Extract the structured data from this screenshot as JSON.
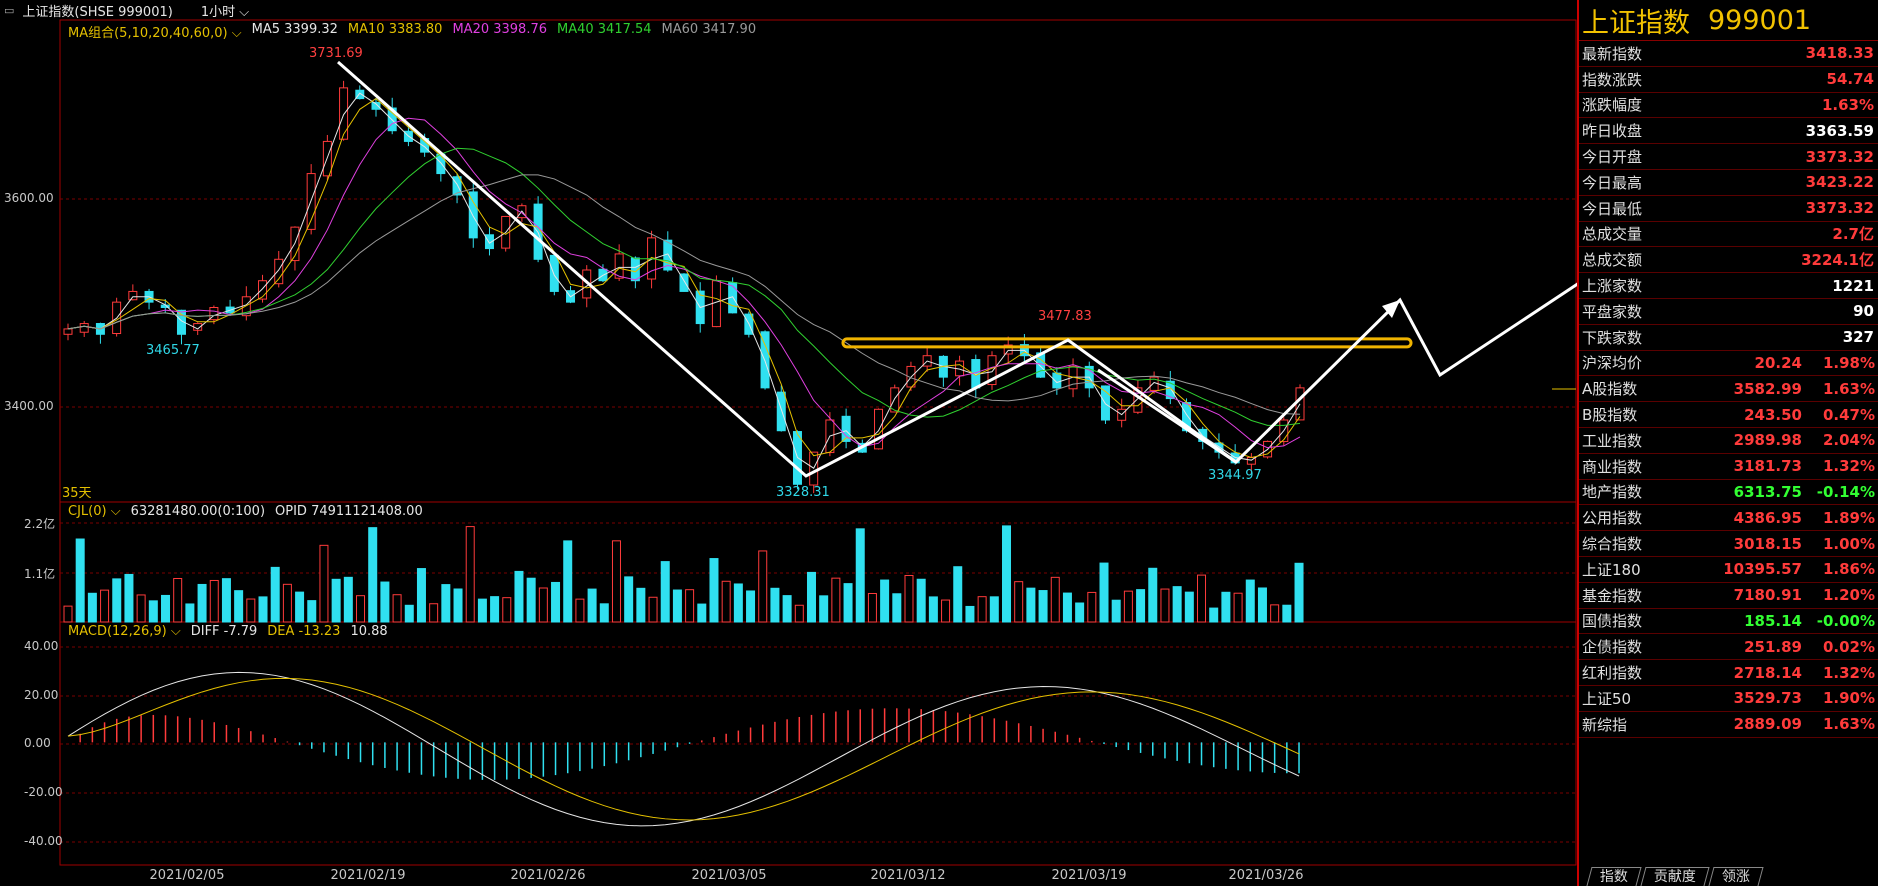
{
  "window": {
    "title": "上证指数(SHSE 999001)",
    "timeframe": "1小时"
  },
  "legends": {
    "ma": [
      {
        "text": "MA组合(5,10,20,40,60,0)",
        "color": "#e4c000"
      },
      {
        "text": "MA5 3399.32",
        "color": "#e6e6e6"
      },
      {
        "text": "MA10 3383.80",
        "color": "#e4c000"
      },
      {
        "text": "MA20 3398.76",
        "color": "#e040e0"
      },
      {
        "text": "MA40 3417.54",
        "color": "#30d030"
      },
      {
        "text": "MA60 3417.90",
        "color": "#9a9a9a"
      }
    ],
    "vol": [
      {
        "text": "CJL(0)",
        "color": "#e4c000"
      },
      {
        "text": "63281480.00(0:100)",
        "color": "#e6e6e6"
      },
      {
        "text": "OPID 74911121408.00",
        "color": "#e6e6e6"
      }
    ],
    "macd": [
      {
        "text": "MACD(12,26,9)",
        "color": "#e4c000"
      },
      {
        "text": "DIFF -7.79",
        "color": "#e6e6e6"
      },
      {
        "text": "DEA -13.23",
        "color": "#e4c000"
      },
      {
        "text": "10.88",
        "color": "#e6e6e6"
      }
    ]
  },
  "price_axis": [
    "3600.00",
    "3400.00"
  ],
  "vol_axis": [
    "2.2亿",
    "1.1亿"
  ],
  "macd_axis": [
    "40.00",
    "20.00",
    "0.00",
    "-20.00",
    "-40.00"
  ],
  "dates": [
    "2021/02/05",
    "2021/02/19",
    "2021/02/26",
    "2021/03/05",
    "2021/03/12",
    "2021/03/19",
    "2021/03/26"
  ],
  "days_label": "35天",
  "annotations": [
    {
      "text": "3731.69",
      "color": "#ff4040"
    },
    {
      "text": "3465.77",
      "color": "#30d8e8"
    },
    {
      "text": "3328.31",
      "color": "#30d8e8"
    },
    {
      "text": "3477.83",
      "color": "#ff4040"
    },
    {
      "text": "3344.97",
      "color": "#30d8e8"
    }
  ],
  "panel": {
    "title": "上证指数",
    "code": "999001",
    "stats": [
      {
        "label": "最新指数",
        "value": "3418.33",
        "color": "red"
      },
      {
        "label": "指数涨跌",
        "value": "54.74",
        "color": "red"
      },
      {
        "label": "涨跌幅度",
        "value": "1.63%",
        "color": "red"
      },
      {
        "label": "昨日收盘",
        "value": "3363.59",
        "color": "white"
      },
      {
        "label": "今日开盘",
        "value": "3373.32",
        "color": "red"
      },
      {
        "label": "今日最高",
        "value": "3423.22",
        "color": "red"
      },
      {
        "label": "今日最低",
        "value": "3373.32",
        "color": "red"
      },
      {
        "label": "总成交量",
        "value": "2.7亿",
        "color": "red"
      },
      {
        "label": "总成交额",
        "value": "3224.1亿",
        "color": "red"
      }
    ],
    "breadth": [
      {
        "label": "上涨家数",
        "value": "1221",
        "color": "white"
      },
      {
        "label": "平盘家数",
        "value": "90",
        "color": "white"
      },
      {
        "label": "下跌家数",
        "value": "327",
        "color": "white"
      }
    ],
    "avg": {
      "label": "沪深均价",
      "value": "20.24",
      "pct": "1.98%"
    },
    "indices": [
      {
        "label": "A股指数",
        "value": "3582.99",
        "pct": "1.63%",
        "vc": "red",
        "pc": "red"
      },
      {
        "label": "B股指数",
        "value": "243.50",
        "pct": "0.47%",
        "vc": "red",
        "pc": "red"
      },
      {
        "label": "工业指数",
        "value": "2989.98",
        "pct": "2.04%",
        "vc": "red",
        "pc": "red"
      },
      {
        "label": "商业指数",
        "value": "3181.73",
        "pct": "1.32%",
        "vc": "red",
        "pc": "red"
      },
      {
        "label": "地产指数",
        "value": "6313.75",
        "pct": "-0.14%",
        "vc": "green",
        "pc": "green"
      },
      {
        "label": "公用指数",
        "value": "4386.95",
        "pct": "1.89%",
        "vc": "red",
        "pc": "red"
      },
      {
        "label": "综合指数",
        "value": "3018.15",
        "pct": "1.00%",
        "vc": "red",
        "pc": "red"
      },
      {
        "label": "上证180",
        "value": "10395.57",
        "pct": "1.86%",
        "vc": "red",
        "pc": "red"
      },
      {
        "label": "基金指数",
        "value": "7180.91",
        "pct": "1.20%",
        "vc": "red",
        "pc": "red"
      },
      {
        "label": "国债指数",
        "value": "185.14",
        "pct": "-0.00%",
        "vc": "green",
        "pc": "green"
      },
      {
        "label": "企债指数",
        "value": "251.89",
        "pct": "0.02%",
        "vc": "red",
        "pc": "red"
      },
      {
        "label": "红利指数",
        "value": "2718.14",
        "pct": "1.32%",
        "vc": "red",
        "pc": "red"
      },
      {
        "label": "上证50",
        "value": "3529.73",
        "pct": "1.90%",
        "vc": "red",
        "pc": "red"
      },
      {
        "label": "新综指",
        "value": "2889.09",
        "pct": "1.63%",
        "vc": "red",
        "pc": "red"
      }
    ],
    "tabs": [
      "指数",
      "贡献度",
      "领涨"
    ]
  },
  "chart_data": {
    "type": "candlestick",
    "price_range": [
      3320,
      3740
    ],
    "close_path": [
      3475,
      3480,
      3470,
      3500,
      3510,
      3500,
      3495,
      3470,
      3480,
      3495,
      3490,
      3505,
      3520,
      3540,
      3570,
      3620,
      3650,
      3700,
      3690,
      3680,
      3660,
      3650,
      3640,
      3620,
      3600,
      3560,
      3550,
      3580,
      3590,
      3540,
      3510,
      3500,
      3530,
      3520,
      3545,
      3520,
      3560,
      3530,
      3510,
      3480,
      3520,
      3490,
      3470,
      3420,
      3380,
      3330,
      3360,
      3390,
      3370,
      3360,
      3400,
      3420,
      3440,
      3450,
      3430,
      3445,
      3420,
      3450,
      3460,
      3450,
      3430,
      3420,
      3440,
      3420,
      3390,
      3400,
      3420,
      3430,
      3410,
      3380,
      3370,
      3360,
      3350,
      3355,
      3370,
      3390,
      3420
    ],
    "key_points": [
      {
        "label": "3731.69",
        "price": 3731.69
      },
      {
        "label": "3465.77",
        "price": 3465.77
      },
      {
        "label": "3328.31",
        "price": 3328.31
      },
      {
        "label": "3477.83",
        "price": 3477.83
      },
      {
        "label": "3344.97",
        "price": 3344.97
      }
    ],
    "resistance_level": 3462,
    "macd_range": [
      -48,
      45
    ],
    "volume_max": 2.2
  }
}
